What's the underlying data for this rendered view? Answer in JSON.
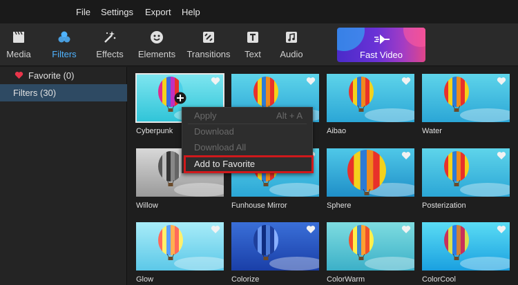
{
  "menu": {
    "items": [
      "File",
      "Settings",
      "Export",
      "Help"
    ]
  },
  "toolbar": {
    "tools": [
      {
        "label": "Media",
        "icon": "film-clapper-icon"
      },
      {
        "label": "Filters",
        "icon": "filters-circles-icon",
        "active": true
      },
      {
        "label": "Effects",
        "icon": "magic-wand-icon"
      },
      {
        "label": "Elements",
        "icon": "smiley-face-icon"
      },
      {
        "label": "Transitions",
        "icon": "transition-icon"
      },
      {
        "label": "Text",
        "icon": "text-t-icon"
      },
      {
        "label": "Audio",
        "icon": "music-note-icon"
      }
    ],
    "fast_video": {
      "label": "Fast Video",
      "icon": "fast-forward-arrow-icon"
    }
  },
  "sidebar": {
    "items": [
      {
        "label": "Favorite (0)",
        "icon": "heart-icon"
      },
      {
        "label": "Filters (30)",
        "selected": true
      }
    ]
  },
  "filters": [
    {
      "name": "Cyberpunk",
      "style": "cyberpunk"
    },
    {
      "name": "",
      "style": "normal"
    },
    {
      "name": "Aibao",
      "style": "normal"
    },
    {
      "name": "Water",
      "style": "normal"
    },
    {
      "name": "Willow",
      "style": "gray"
    },
    {
      "name": "Funhouse Mirror",
      "style": "normal"
    },
    {
      "name": "Sphere",
      "style": "sphere"
    },
    {
      "name": "Posterization",
      "style": "normal"
    },
    {
      "name": "Glow",
      "style": "glow"
    },
    {
      "name": "Colorize",
      "style": "blue"
    },
    {
      "name": "ColorWarm",
      "style": "warm"
    },
    {
      "name": "ColorCool",
      "style": "cool"
    }
  ],
  "context_menu": {
    "items": [
      {
        "label": "Apply",
        "shortcut": "Alt + A",
        "enabled": false
      },
      {
        "label": "Download",
        "shortcut": "",
        "enabled": false
      },
      {
        "label": "Download All",
        "shortcut": "",
        "enabled": false
      },
      {
        "label": "Add to Favorite",
        "shortcut": "",
        "enabled": true,
        "highlighted": true
      }
    ]
  },
  "colors": {
    "accent": "#4fb3ff",
    "selection": "#2e4a63",
    "highlight_border": "#d0191b",
    "favorite": "#e8354a"
  }
}
